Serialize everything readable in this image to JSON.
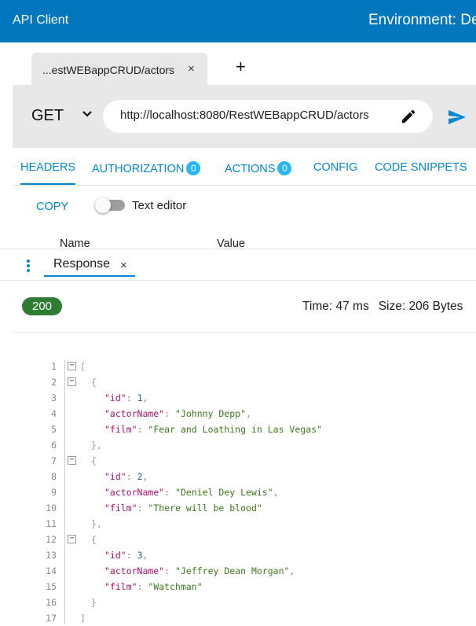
{
  "appbar": {
    "title": "API Client",
    "environment": "Environment: De"
  },
  "request_tab": {
    "label": "...estWEBappCRUD/actors",
    "close": "×",
    "add": "+"
  },
  "request": {
    "method": "GET",
    "url": "http://localhost:8080/RestWEBappCRUD/actors"
  },
  "subtabs": [
    {
      "label": "HEADERS"
    },
    {
      "label": "AUTHORIZATION",
      "badge": "0"
    },
    {
      "label": "ACTIONS",
      "badge": "0"
    },
    {
      "label": "CONFIG"
    },
    {
      "label": "CODE SNIPPETS"
    }
  ],
  "headers_panel": {
    "copy": "COPY",
    "text_editor": "Text editor",
    "col_name": "Name",
    "col_value": "Value"
  },
  "response_tab": {
    "label": "Response",
    "close": "×"
  },
  "response": {
    "status": "200",
    "time": "Time: 47 ms",
    "size": "Size: 206 Bytes"
  },
  "code_lines": [
    {
      "n": "1",
      "text": "["
    },
    {
      "n": "2",
      "text": "{"
    },
    {
      "n": "3",
      "key": "\"id\"",
      "value": "1",
      "vtype": "num",
      "comma": ","
    },
    {
      "n": "4",
      "key": "\"actorName\"",
      "value": "\"Johnny Depp\"",
      "vtype": "str",
      "comma": ","
    },
    {
      "n": "5",
      "key": "\"film\"",
      "value": "\"Fear and Loathing in Las Vegas\"",
      "vtype": "str",
      "comma": ""
    },
    {
      "n": "6",
      "text": "},"
    },
    {
      "n": "7",
      "text": "{"
    },
    {
      "n": "8",
      "key": "\"id\"",
      "value": "2",
      "vtype": "num",
      "comma": ","
    },
    {
      "n": "9",
      "key": "\"actorName\"",
      "value": "\"Deniel Dey Lewis\"",
      "vtype": "str",
      "comma": ","
    },
    {
      "n": "10",
      "key": "\"film\"",
      "value": "\"There will be blood\"",
      "vtype": "str",
      "comma": ""
    },
    {
      "n": "11",
      "text": "},"
    },
    {
      "n": "12",
      "text": "{"
    },
    {
      "n": "13",
      "key": "\"id\"",
      "value": "3",
      "vtype": "num",
      "comma": ","
    },
    {
      "n": "14",
      "key": "\"actorName\"",
      "value": "\"Jeffrey Dean Morgan\"",
      "vtype": "str",
      "comma": ","
    },
    {
      "n": "15",
      "key": "\"film\"",
      "value": "\"Watchman\"",
      "vtype": "str",
      "comma": ""
    },
    {
      "n": "16",
      "text": "}"
    },
    {
      "n": "17",
      "text": "]"
    }
  ],
  "icons": {
    "method_dropdown": "chevron-down-icon",
    "edit": "pencil-icon",
    "send": "send-icon",
    "menu": "kebab-icon",
    "fold": "minus-icon"
  },
  "colors": {
    "primary": "#0277bd",
    "accent": "#0288d1",
    "success": "#2e7d32",
    "badge": "#29b6f6"
  }
}
